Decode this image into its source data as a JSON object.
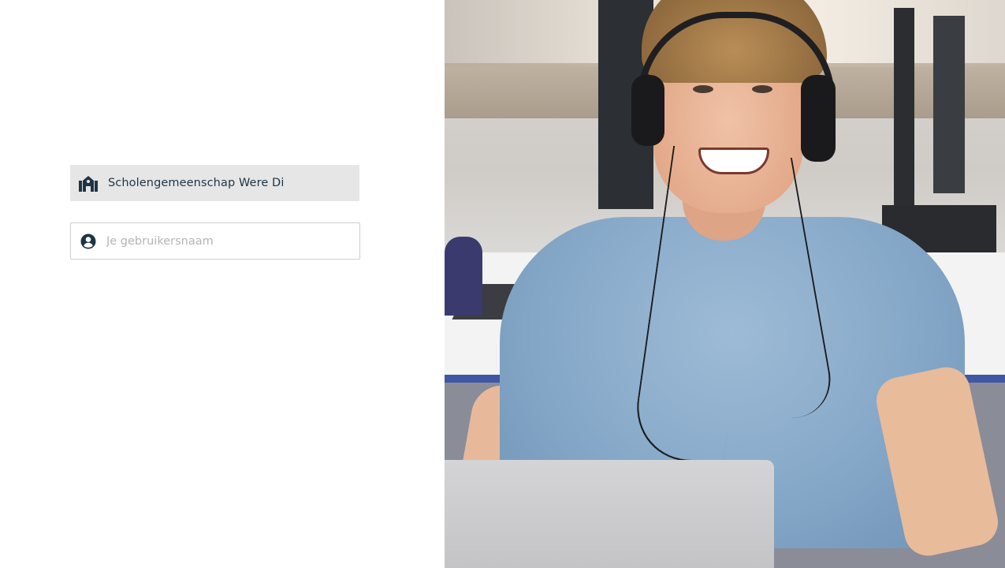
{
  "login": {
    "school_name": "Scholengemeenschap Were Di",
    "username_placeholder": "Je gebruikersnaam",
    "username_value": ""
  },
  "icons": {
    "school": "school-building-icon",
    "user": "user-circle-icon"
  },
  "colors": {
    "text_primary": "#1d3446",
    "school_box_bg": "#e6e6e6",
    "placeholder": "#b4b4b4",
    "field_border": "#cfcfcf"
  }
}
